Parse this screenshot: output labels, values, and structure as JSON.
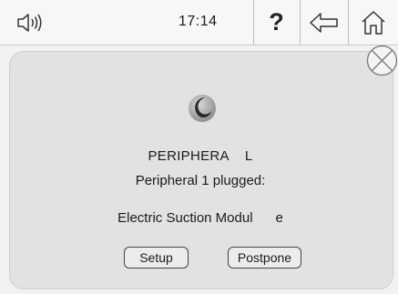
{
  "status_bar": {
    "time": "17:14",
    "help_label": "?",
    "sound_icon": "speaker-icon",
    "back_icon": "back-arrow-icon",
    "home_icon": "home-icon"
  },
  "dialog": {
    "close_icon": "close-icon",
    "logo_icon": "peripheral-logo-icon",
    "title": "PERIPHERA    L",
    "message": "Peripheral 1 plugged:",
    "module_name": "Electric Suction Modul      e",
    "setup_label": "Setup",
    "postpone_label": "Postpone"
  }
}
